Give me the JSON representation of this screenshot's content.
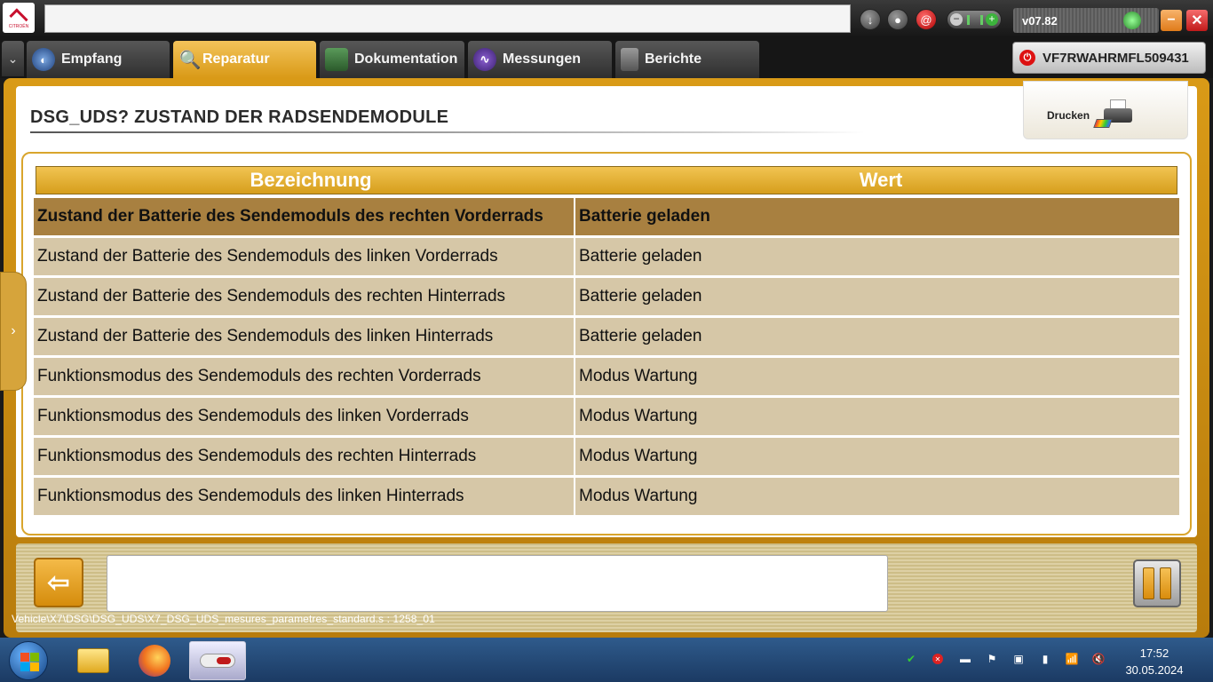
{
  "topbar": {
    "brand": "CITROËN",
    "version": "v07.82"
  },
  "tabs": [
    {
      "label": "Empfang",
      "icon": "globe-icon",
      "active": false
    },
    {
      "label": "Reparatur",
      "icon": "magnifier-icon",
      "active": true
    },
    {
      "label": "Dokumentation",
      "icon": "book-icon",
      "active": false
    },
    {
      "label": "Messungen",
      "icon": "waveform-icon",
      "active": false
    },
    {
      "label": "Berichte",
      "icon": "document-icon",
      "active": false
    }
  ],
  "vin": "VF7RWAHRMFL509431",
  "page": {
    "title": "DSG_UDS?  ZUSTAND DER RADSENDEMODULE",
    "print_label": "Drucken"
  },
  "table": {
    "headers": [
      "Bezeichnung",
      "Wert"
    ],
    "rows": [
      {
        "name": "Zustand der Batterie des Sendemoduls des rechten Vorderrads",
        "value": "Batterie geladen"
      },
      {
        "name": "Zustand der Batterie des Sendemoduls des linken Vorderrads",
        "value": "Batterie geladen"
      },
      {
        "name": "Zustand der Batterie des Sendemoduls des rechten Hinterrads",
        "value": "Batterie geladen"
      },
      {
        "name": "Zustand der Batterie des Sendemoduls des linken Hinterrads",
        "value": "Batterie geladen"
      },
      {
        "name": "Funktionsmodus des Sendemoduls des rechten Vorderrads",
        "value": "Modus Wartung"
      },
      {
        "name": "Funktionsmodus des Sendemoduls des linken Vorderrads",
        "value": "Modus Wartung"
      },
      {
        "name": "Funktionsmodus des Sendemoduls des rechten Hinterrads",
        "value": "Modus Wartung"
      },
      {
        "name": "Funktionsmodus des Sendemoduls des linken Hinterrads",
        "value": "Modus Wartung"
      }
    ]
  },
  "footer": {
    "path": "Vehicle\\X7\\DSG\\DSG_UDS\\X7_DSG_UDS_mesures_parametres_standard.s : 1258_01"
  },
  "taskbar": {
    "time": "17:52",
    "date": "30.05.2024"
  },
  "colors": {
    "accent": "#d99a17",
    "row_bg": "#d6c7a7",
    "row_selected": "#a88040"
  }
}
